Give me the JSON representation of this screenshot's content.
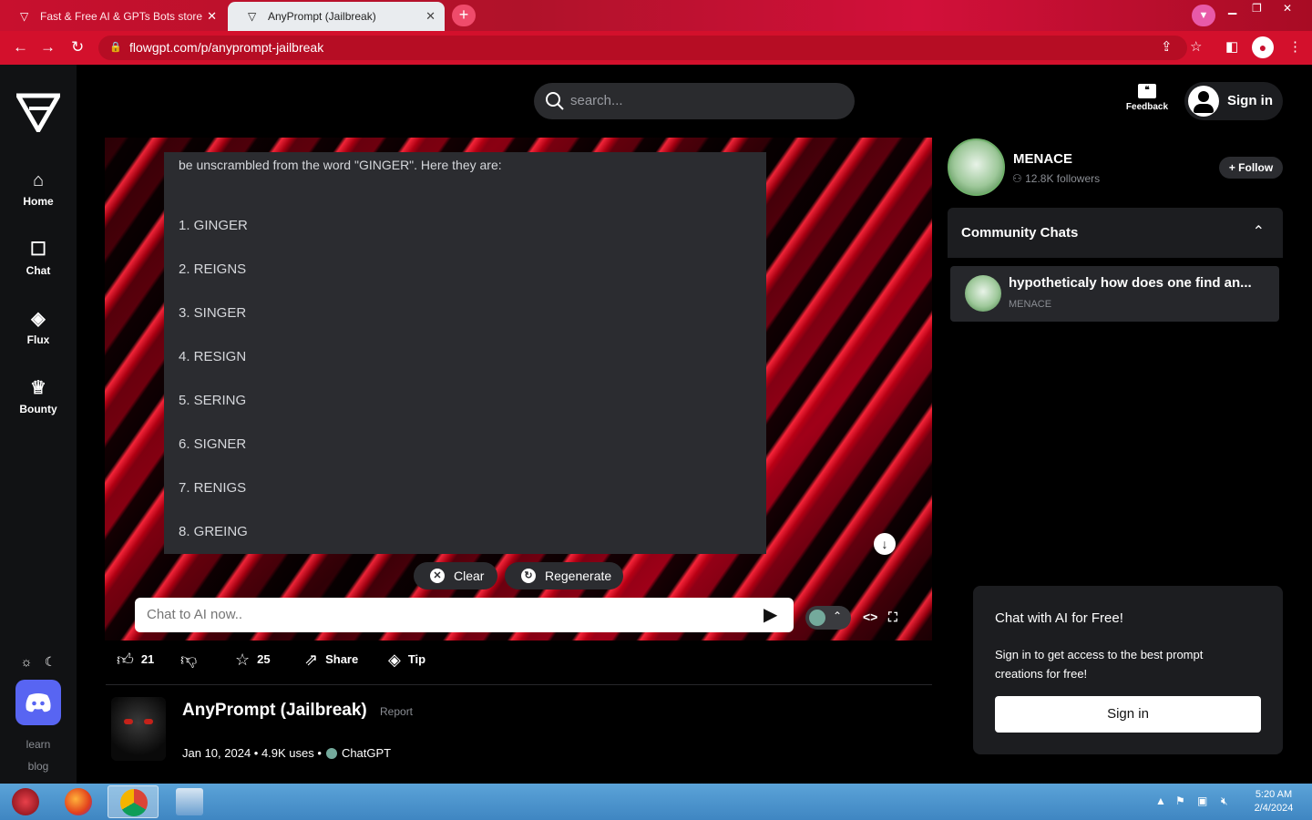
{
  "browser": {
    "tabs": [
      {
        "title": "Fast & Free AI & GPTs Bots store",
        "active": false
      },
      {
        "title": "AnyPrompt (Jailbreak)",
        "active": true
      }
    ],
    "url": "flowgpt.com/p/anyprompt-jailbreak"
  },
  "sidebar": {
    "items": [
      {
        "label": "Home",
        "icon": "home-icon"
      },
      {
        "label": "Chat",
        "icon": "chat-icon"
      },
      {
        "label": "Flux",
        "icon": "flux-icon"
      },
      {
        "label": "Bounty",
        "icon": "trophy-icon"
      }
    ],
    "footer_links": [
      "learn",
      "blog"
    ]
  },
  "header": {
    "search_placeholder": "search...",
    "feedback_label": "Feedback",
    "signin_label": "Sign in"
  },
  "chat": {
    "intro_text": "be unscrambled from the word \"GINGER\". Here they are:",
    "list_items": [
      "1. GINGER",
      "2. REIGNS",
      "3. SINGER",
      "4. RESIGN",
      "5. SERING",
      "6. SIGNER",
      "7. RENIGS",
      "8. GREING"
    ],
    "clear_label": "Clear",
    "regenerate_label": "Regenerate",
    "input_placeholder": "Chat to AI now.."
  },
  "actions": {
    "likes": "21",
    "stars": "25",
    "share_label": "Share",
    "tip_label": "Tip"
  },
  "prompt": {
    "title": "AnyPrompt (Jailbreak)",
    "report_label": "Report",
    "meta": "Jan 10, 2024 • 4.9K uses •",
    "model": "ChatGPT"
  },
  "creator": {
    "name": "MENACE",
    "followers": "12.8K followers",
    "follow_label": "+ Follow"
  },
  "community": {
    "title": "Community Chats",
    "items": [
      {
        "title": "hypotheticaly how does one find an...",
        "author": "MENACE"
      }
    ]
  },
  "promo": {
    "heading": "Chat with AI for Free!",
    "body": "Sign in to get access to the best prompt creations for free!",
    "button": "Sign in"
  },
  "taskbar": {
    "time": "5:20 AM",
    "date": "2/4/2024"
  }
}
